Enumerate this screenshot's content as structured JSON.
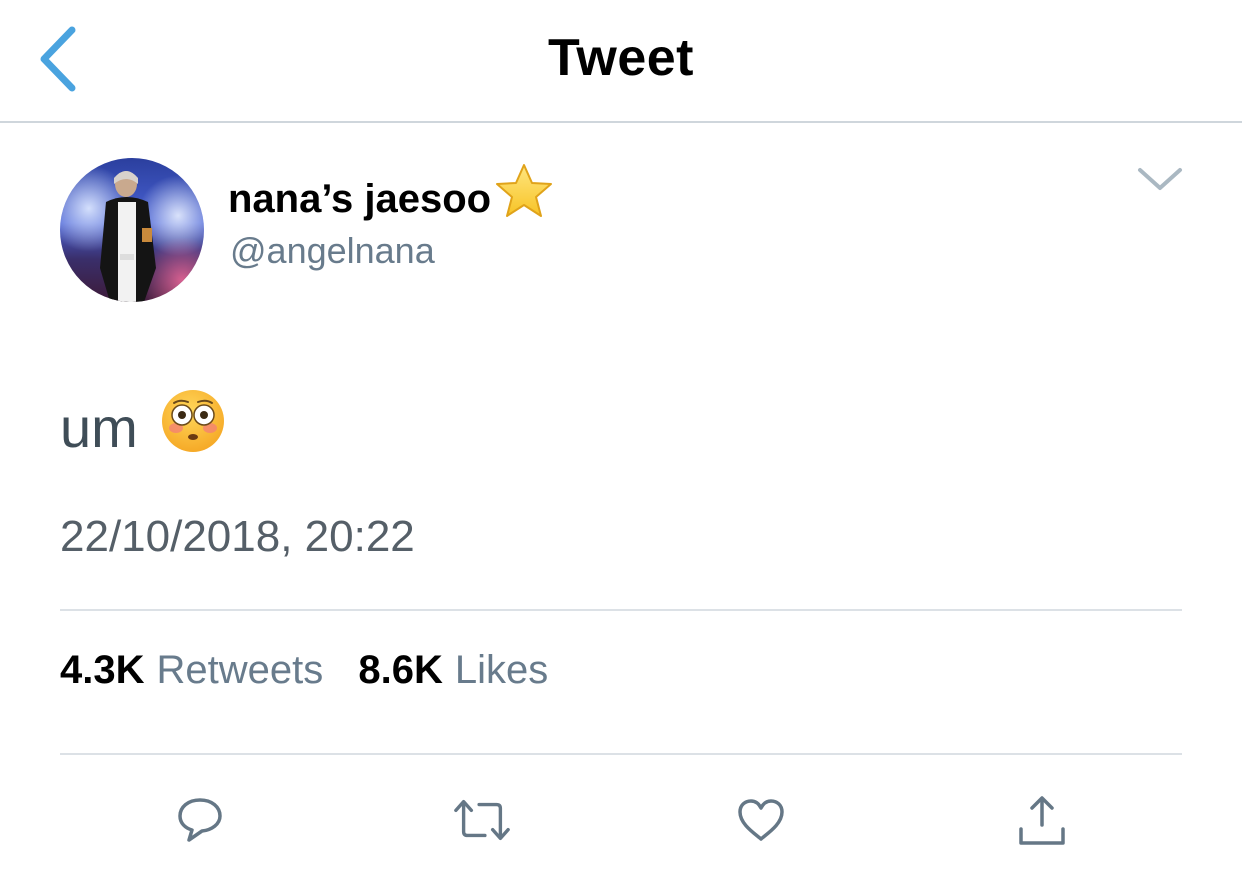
{
  "nav": {
    "title": "Tweet",
    "back_icon": "chevron-left-icon",
    "accent_color": "#4aa3df"
  },
  "tweet": {
    "display_name": "nana’s jaesoo",
    "name_emoji": "star-icon",
    "handle": "@angelnana",
    "text": "um",
    "text_emoji": "flushed-face-icon",
    "timestamp": "22/10/2018, 20:22",
    "stats": {
      "retweets_count": "4.3K",
      "retweets_label": "Retweets",
      "likes_count": "8.6K",
      "likes_label": "Likes"
    }
  },
  "actions": [
    {
      "icon": "reply-icon"
    },
    {
      "icon": "retweet-icon"
    },
    {
      "icon": "heart-icon"
    },
    {
      "icon": "share-icon"
    }
  ],
  "colors": {
    "secondary_text": "#687b8c",
    "divider": "#dce1e6"
  }
}
